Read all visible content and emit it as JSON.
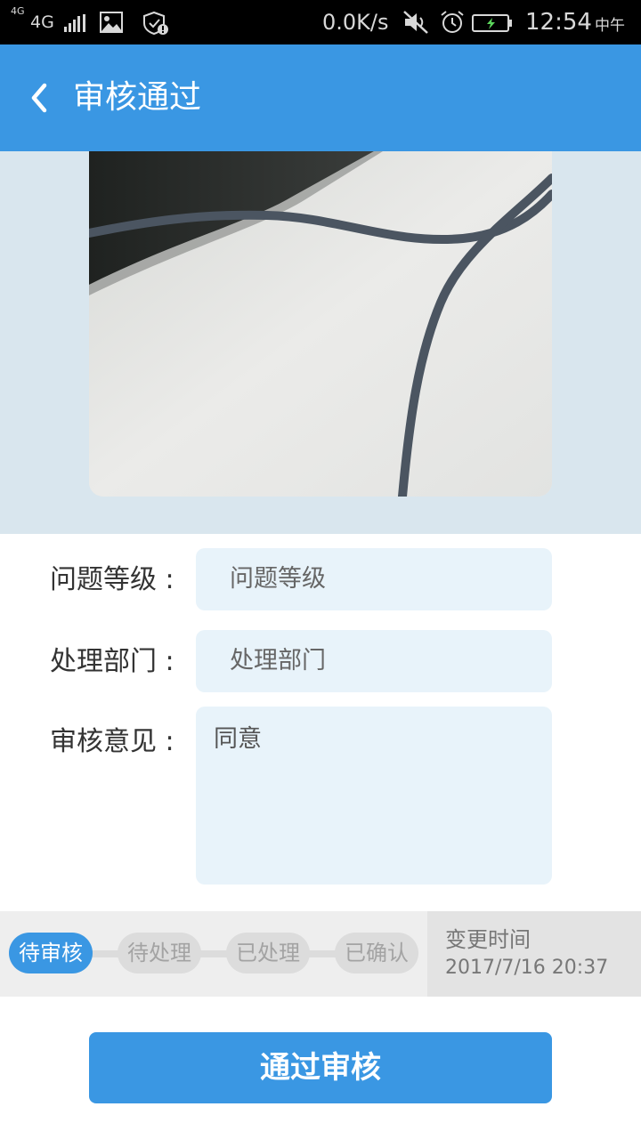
{
  "status_bar": {
    "network_small": "4G",
    "network": "4G",
    "speed": "0.0K/s",
    "time": "12:54",
    "ampm": "中午",
    "icons": [
      "signal-icon",
      "image-icon",
      "shield-icon",
      "mute-icon",
      "alarm-icon",
      "battery-icon"
    ]
  },
  "header": {
    "title": "审核通过",
    "background": "#3a97e3"
  },
  "form": {
    "level_label": "问题等级 :",
    "level_placeholder": "问题等级",
    "dept_label": "处理部门 :",
    "dept_placeholder": "处理部门",
    "opinion_label": "审核意见 :",
    "opinion_value": "同意"
  },
  "progress": {
    "steps": [
      {
        "label": "待审核",
        "active": true
      },
      {
        "label": "待处理",
        "active": false
      },
      {
        "label": "已处理",
        "active": false
      },
      {
        "label": "已确认",
        "active": false
      }
    ],
    "change_time_label": "变更时间",
    "change_time_value": "2017/7/16 20:37"
  },
  "actions": {
    "approve_label": "通过审核"
  }
}
